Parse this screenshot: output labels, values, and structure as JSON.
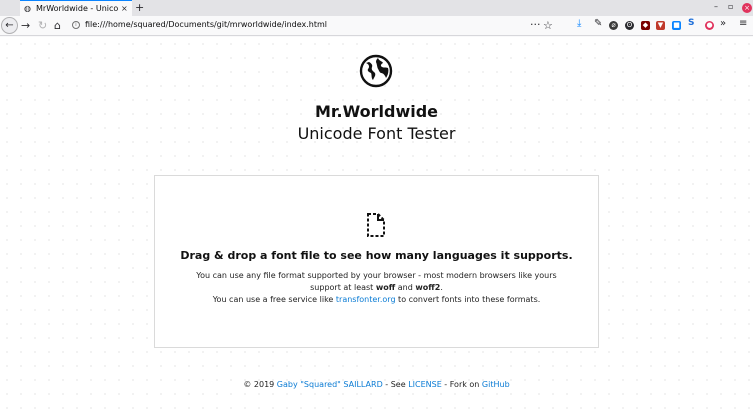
{
  "browser": {
    "tab": {
      "title": "MrWorldwide - Unicode Font Tester",
      "close": "×"
    },
    "new_tab": "+",
    "window": {
      "minimize": "–",
      "maximize": "▫",
      "close": "×"
    },
    "nav": {
      "back": "←",
      "forward": "→",
      "reload": "↻",
      "home": "⌂",
      "url": "file:///home/squared/Documents/git/mrworldwide/index.html",
      "page_actions": "···",
      "bookmark": "☆",
      "overflow": "»",
      "menu": "≡"
    },
    "toolbar_icons": [
      "download-icon",
      "wrench-icon",
      "extension-icon",
      "extension-icon",
      "extension-icon",
      "extension-icon",
      "extension-icon",
      "extension-icon",
      "extension-icon",
      "extension-icon"
    ]
  },
  "page": {
    "title": "Mr.Worldwide",
    "subtitle": "Unicode Font Tester",
    "dropzone": {
      "heading": "Drag & drop a font file to see how many languages it supports.",
      "line1_a": "You can use any file format supported by your browser - most modern browsers like yours support at least ",
      "woff": "woff",
      "and": " and ",
      "woff2": "woff2",
      "period": ".",
      "line2_a": "You can use a free service like ",
      "transfonter": "transfonter.org",
      "line2_b": " to convert fonts into these formats."
    },
    "footer": {
      "prefix": "© 2019 ",
      "author": "Gaby \"Squared\" SAILLARD",
      "sep1": " - See ",
      "license": "LICENSE",
      "sep2": " - Fork on ",
      "github": "GitHub"
    }
  }
}
